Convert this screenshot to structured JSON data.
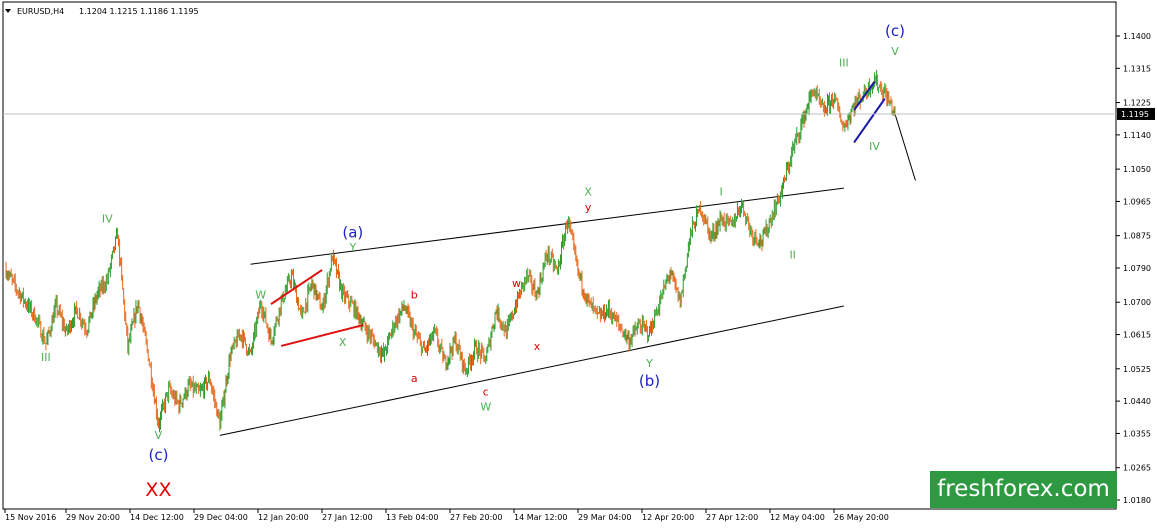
{
  "header": {
    "symbol": "EURUSD,H4",
    "ohlc": "1.1204 1.1215 1.1186 1.1195",
    "dropdown_icon": "triangle-down-icon"
  },
  "watermark": "freshforex.com",
  "colors": {
    "bull": "#2e9b2e",
    "bear": "#e8671a",
    "wave_green": "#4caf50",
    "wave_red": "#e00000",
    "wave_blue": "#1c21c9",
    "channel": "#000000",
    "triangle_red": "#e01010",
    "triangle_blue": "#1a1aa8",
    "brand": "#2d9940"
  },
  "chart_data": {
    "type": "candlestick",
    "instrument": "EURUSD",
    "timeframe": "H4",
    "grid": false,
    "ylim": [
      1.018,
      1.148
    ],
    "y_ticks": [
      1.018,
      1.0265,
      1.0355,
      1.044,
      1.0525,
      1.0615,
      1.07,
      1.079,
      1.0875,
      1.0965,
      1.105,
      1.114,
      1.1225,
      1.1315,
      1.14
    ],
    "y_tick_labels": [
      "1.0180",
      "1.0265",
      "1.0355",
      "1.0440",
      "1.0525",
      "1.0615",
      "1.0700",
      "1.0790",
      "1.0875",
      "1.0965",
      "1.1050",
      "1.1140",
      "1.1225",
      "1.1315",
      "1.1400"
    ],
    "x_tick_labels": [
      "15 Nov 2016",
      "29 Nov 20:00",
      "14 Dec 12:00",
      "29 Dec 04:00",
      "12 Jan 20:00",
      "27 Jan 12:00",
      "13 Feb 04:00",
      "27 Feb 20:00",
      "14 Mar 12:00",
      "29 Mar 04:00",
      "12 Apr 20:00",
      "27 Apr 12:00",
      "12 May 04:00",
      "26 May 20:00"
    ],
    "current_price": 1.1195,
    "current_price_label": "1.1195",
    "price_path": [
      {
        "i": 0,
        "p": 1.079
      },
      {
        "i": 1,
        "p": 1.074
      },
      {
        "i": 2,
        "p": 1.07
      },
      {
        "i": 3,
        "p": 1.066
      },
      {
        "i": 4,
        "p": 1.059
      },
      {
        "i": 5,
        "p": 1.069
      },
      {
        "i": 6,
        "p": 1.062
      },
      {
        "i": 7,
        "p": 1.068
      },
      {
        "i": 8,
        "p": 1.063
      },
      {
        "i": 9,
        "p": 1.072
      },
      {
        "i": 10,
        "p": 1.076
      },
      {
        "i": 11,
        "p": 1.088
      },
      {
        "i": 12,
        "p": 1.058
      },
      {
        "i": 13,
        "p": 1.07
      },
      {
        "i": 14,
        "p": 1.056
      },
      {
        "i": 15,
        "p": 1.038
      },
      {
        "i": 16,
        "p": 1.047
      },
      {
        "i": 17,
        "p": 1.043
      },
      {
        "i": 18,
        "p": 1.048
      },
      {
        "i": 19,
        "p": 1.046
      },
      {
        "i": 20,
        "p": 1.05
      },
      {
        "i": 21,
        "p": 1.038
      },
      {
        "i": 22,
        "p": 1.056
      },
      {
        "i": 23,
        "p": 1.062
      },
      {
        "i": 24,
        "p": 1.056
      },
      {
        "i": 25,
        "p": 1.07
      },
      {
        "i": 26,
        "p": 1.06
      },
      {
        "i": 27,
        "p": 1.07
      },
      {
        "i": 28,
        "p": 1.077
      },
      {
        "i": 29,
        "p": 1.066
      },
      {
        "i": 30,
        "p": 1.075
      },
      {
        "i": 31,
        "p": 1.068
      },
      {
        "i": 32,
        "p": 1.082
      },
      {
        "i": 33,
        "p": 1.072
      },
      {
        "i": 34,
        "p": 1.069
      },
      {
        "i": 35,
        "p": 1.064
      },
      {
        "i": 36,
        "p": 1.06
      },
      {
        "i": 37,
        "p": 1.056
      },
      {
        "i": 38,
        "p": 1.064
      },
      {
        "i": 39,
        "p": 1.069
      },
      {
        "i": 40,
        "p": 1.062
      },
      {
        "i": 41,
        "p": 1.057
      },
      {
        "i": 42,
        "p": 1.062
      },
      {
        "i": 43,
        "p": 1.054
      },
      {
        "i": 44,
        "p": 1.06
      },
      {
        "i": 45,
        "p": 1.052
      },
      {
        "i": 46,
        "p": 1.058
      },
      {
        "i": 47,
        "p": 1.055
      },
      {
        "i": 48,
        "p": 1.068
      },
      {
        "i": 49,
        "p": 1.062
      },
      {
        "i": 50,
        "p": 1.07
      },
      {
        "i": 51,
        "p": 1.077
      },
      {
        "i": 52,
        "p": 1.072
      },
      {
        "i": 53,
        "p": 1.083
      },
      {
        "i": 54,
        "p": 1.078
      },
      {
        "i": 55,
        "p": 1.092
      },
      {
        "i": 56,
        "p": 1.078
      },
      {
        "i": 57,
        "p": 1.07
      },
      {
        "i": 58,
        "p": 1.066
      },
      {
        "i": 59,
        "p": 1.068
      },
      {
        "i": 60,
        "p": 1.064
      },
      {
        "i": 61,
        "p": 1.06
      },
      {
        "i": 62,
        "p": 1.064
      },
      {
        "i": 63,
        "p": 1.062
      },
      {
        "i": 64,
        "p": 1.07
      },
      {
        "i": 65,
        "p": 1.078
      },
      {
        "i": 66,
        "p": 1.07
      },
      {
        "i": 67,
        "p": 1.088
      },
      {
        "i": 68,
        "p": 1.095
      },
      {
        "i": 69,
        "p": 1.087
      },
      {
        "i": 70,
        "p": 1.092
      },
      {
        "i": 71,
        "p": 1.09
      },
      {
        "i": 72,
        "p": 1.096
      },
      {
        "i": 73,
        "p": 1.088
      },
      {
        "i": 74,
        "p": 1.086
      },
      {
        "i": 75,
        "p": 1.093
      },
      {
        "i": 76,
        "p": 1.1
      },
      {
        "i": 77,
        "p": 1.11
      },
      {
        "i": 78,
        "p": 1.118
      },
      {
        "i": 79,
        "p": 1.126
      },
      {
        "i": 80,
        "p": 1.12
      },
      {
        "i": 81,
        "p": 1.124
      },
      {
        "i": 82,
        "p": 1.116
      },
      {
        "i": 83,
        "p": 1.122
      },
      {
        "i": 84,
        "p": 1.125
      },
      {
        "i": 85,
        "p": 1.1285
      },
      {
        "i": 86,
        "p": 1.125
      },
      {
        "i": 87,
        "p": 1.1195
      }
    ],
    "path_length": 88,
    "channels": [
      {
        "name": "upper",
        "from": {
          "i": 24,
          "p": 1.08
        },
        "to": {
          "i": 82,
          "p": 1.1
        }
      },
      {
        "name": "lower",
        "from": {
          "i": 21,
          "p": 1.035
        },
        "to": {
          "i": 82,
          "p": 1.069
        }
      }
    ],
    "triangles": [
      {
        "color": "red",
        "lines": [
          [
            {
              "i": 26,
              "p": 1.0695
            },
            {
              "i": 31,
              "p": 1.0785
            }
          ],
          [
            {
              "i": 27,
              "p": 1.0585
            },
            {
              "i": 35,
              "p": 1.064
            }
          ]
        ]
      },
      {
        "color": "blue",
        "lines": [
          [
            {
              "i": 83,
              "p": 1.1205
            },
            {
              "i": 85,
              "p": 1.128
            }
          ],
          [
            {
              "i": 83,
              "p": 1.112
            },
            {
              "i": 86,
              "p": 1.1235
            }
          ]
        ]
      }
    ],
    "projection": [
      {
        "i": 87,
        "p": 1.1195
      },
      {
        "i": 89,
        "p": 1.102
      }
    ],
    "wave_labels": [
      {
        "text": "III",
        "color": "green",
        "i": 4,
        "p": 1.0545,
        "size": "small"
      },
      {
        "text": "IV",
        "color": "green",
        "i": 10,
        "p": 1.091,
        "size": "small"
      },
      {
        "text": "V",
        "color": "green",
        "i": 15,
        "p": 1.034,
        "size": "small"
      },
      {
        "text": "(c)",
        "color": "blue",
        "i": 15,
        "p": 1.0285,
        "size": "big"
      },
      {
        "text": "XX",
        "color": "red",
        "i": 15,
        "p": 1.019,
        "size": "xx"
      },
      {
        "text": "W",
        "color": "green",
        "i": 25,
        "p": 1.071,
        "size": "small"
      },
      {
        "text": "X",
        "color": "green",
        "i": 33,
        "p": 1.0585,
        "size": "small"
      },
      {
        "text": "(a)",
        "color": "blue",
        "i": 34,
        "p": 1.087,
        "size": "big"
      },
      {
        "text": "Y",
        "color": "green",
        "i": 34,
        "p": 1.0835,
        "size": "small"
      },
      {
        "text": "b",
        "color": "red",
        "i": 40,
        "p": 1.071,
        "size": "small"
      },
      {
        "text": "a",
        "color": "red",
        "i": 40,
        "p": 1.049,
        "size": "small"
      },
      {
        "text": "c",
        "color": "red",
        "i": 47,
        "p": 1.0455,
        "size": "small"
      },
      {
        "text": "W",
        "color": "green",
        "i": 47,
        "p": 1.0415,
        "size": "small"
      },
      {
        "text": "w",
        "color": "red",
        "i": 50,
        "p": 1.074,
        "size": "small"
      },
      {
        "text": "x",
        "color": "red",
        "i": 52,
        "p": 1.0575,
        "size": "small"
      },
      {
        "text": "X",
        "color": "green",
        "i": 57,
        "p": 1.098,
        "size": "small"
      },
      {
        "text": "y",
        "color": "red",
        "i": 57,
        "p": 1.094,
        "size": "small"
      },
      {
        "text": "Y",
        "color": "green",
        "i": 63,
        "p": 1.053,
        "size": "small"
      },
      {
        "text": "(b)",
        "color": "blue",
        "i": 63,
        "p": 1.048,
        "size": "big"
      },
      {
        "text": "I",
        "color": "green",
        "i": 70,
        "p": 1.098,
        "size": "small"
      },
      {
        "text": "II",
        "color": "green",
        "i": 77,
        "p": 1.0815,
        "size": "small"
      },
      {
        "text": "III",
        "color": "green",
        "i": 82,
        "p": 1.132,
        "size": "small"
      },
      {
        "text": "IV",
        "color": "green",
        "i": 85,
        "p": 1.11,
        "size": "small"
      },
      {
        "text": "V",
        "color": "green",
        "i": 87,
        "p": 1.135,
        "size": "small"
      },
      {
        "text": "(c)",
        "color": "blue",
        "i": 87,
        "p": 1.14,
        "size": "big"
      }
    ]
  }
}
